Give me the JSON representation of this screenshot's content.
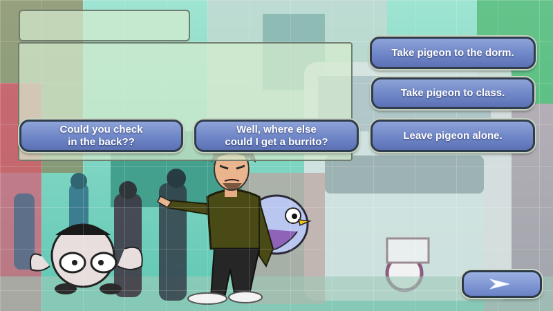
{
  "scene": {
    "speaker_name": "",
    "dialogue_text": ""
  },
  "choices": {
    "dorm": "Take pigeon to the dorm.",
    "class": "Take pigeon to class.",
    "leave": "Leave pigeon alone.",
    "check_back": "Could you check\nin the back??",
    "burrito": "Well, where else\ncould I get a burrito?"
  },
  "next_button": {
    "icon": "arrow-right-icon"
  },
  "colors": {
    "button_fill": "#7289c9",
    "button_border": "#2f3d4d",
    "panel_fill": "#d6ecce"
  }
}
